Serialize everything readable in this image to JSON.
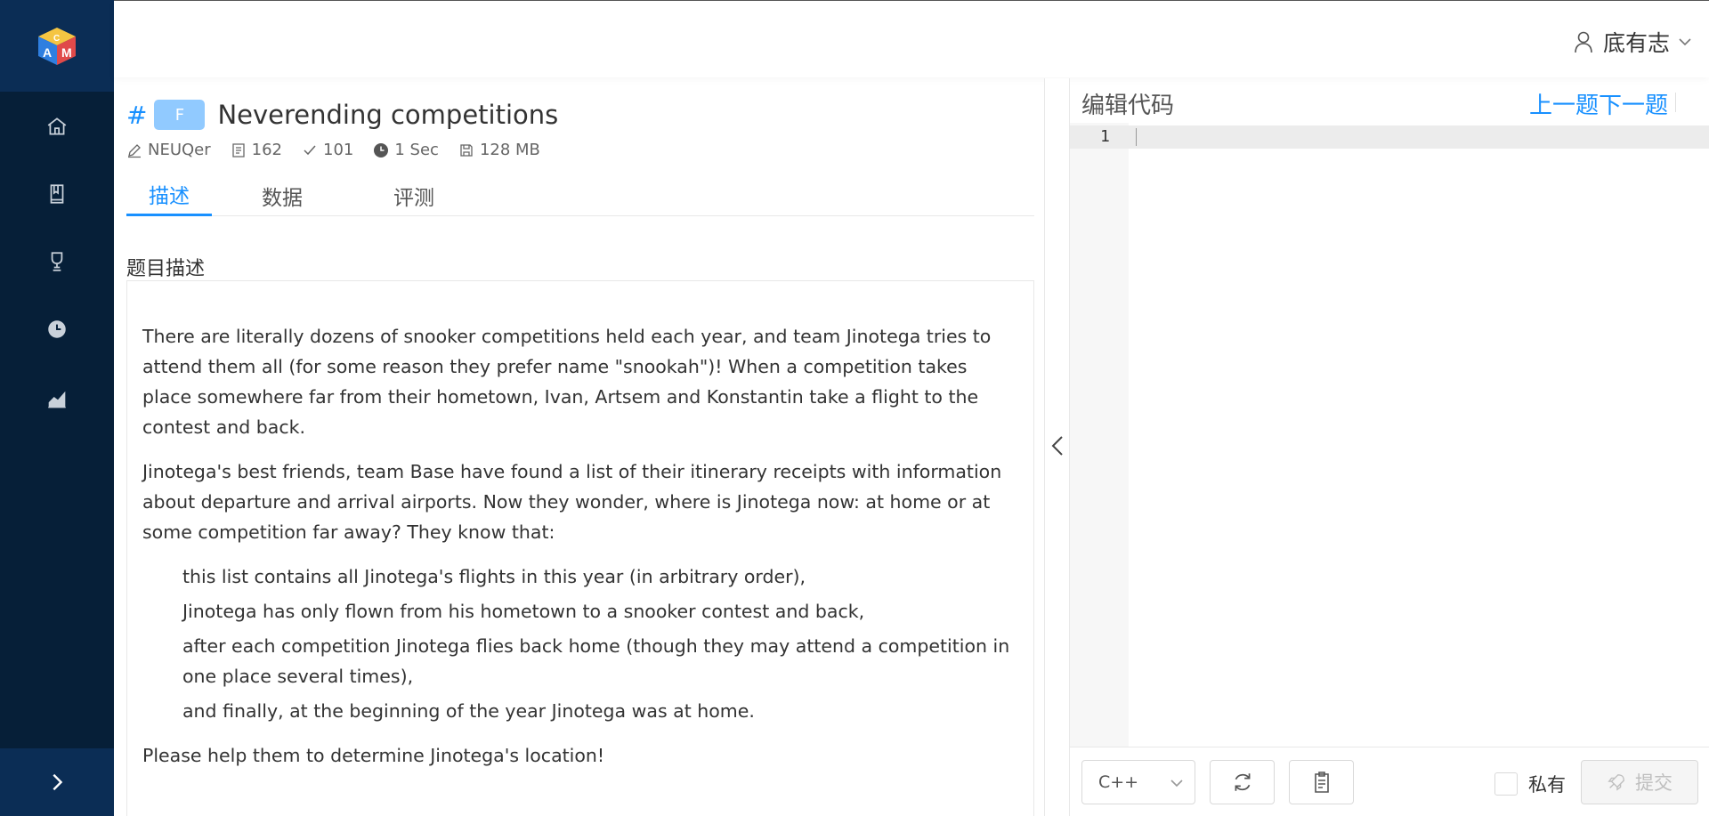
{
  "header": {
    "user_name": "底有志"
  },
  "sidebar": {
    "items": [
      {
        "icon": "home-icon"
      },
      {
        "icon": "book-icon"
      },
      {
        "icon": "trophy-icon"
      },
      {
        "icon": "clock-icon"
      },
      {
        "icon": "chart-icon"
      }
    ]
  },
  "problem": {
    "hash": "#",
    "tag": "F",
    "title": "Neverending competitions",
    "author": "NEUQer",
    "submissions": "162",
    "accepted": "101",
    "time_limit": "1 Sec",
    "memory_limit": "128 MB",
    "tabs": [
      "描述",
      "数据",
      "评测"
    ],
    "section_title": "题目描述",
    "paragraphs": [
      "There are literally dozens of snooker competitions held each year, and team Jinotega tries to attend them all (for some reason they prefer name \"snookah\")! When a competition takes place somewhere far from their hometown, Ivan, Artsem and Konstantin take a flight to the contest and back.",
      "Jinotega's best friends, team Base have found a list of their itinerary receipts with information about departure and arrival airports. Now they wonder, where is Jinotega now: at home or at some competition far away? They know that:"
    ],
    "list": [
      "this list contains all Jinotega's flights in this year (in arbitrary order),",
      "Jinotega has only flown from his hometown to a snooker contest and back,",
      "after each competition Jinotega flies back home (though they may attend a competition in one place several times),",
      "and finally, at the beginning of the year Jinotega was at home."
    ],
    "closing": "Please help them to determine Jinotega's location!"
  },
  "editor": {
    "label": "编辑代码",
    "prev": "上一题",
    "next": "下一题",
    "line_number": "1",
    "language": "C++",
    "private_label": "私有",
    "submit_label": "提交"
  }
}
